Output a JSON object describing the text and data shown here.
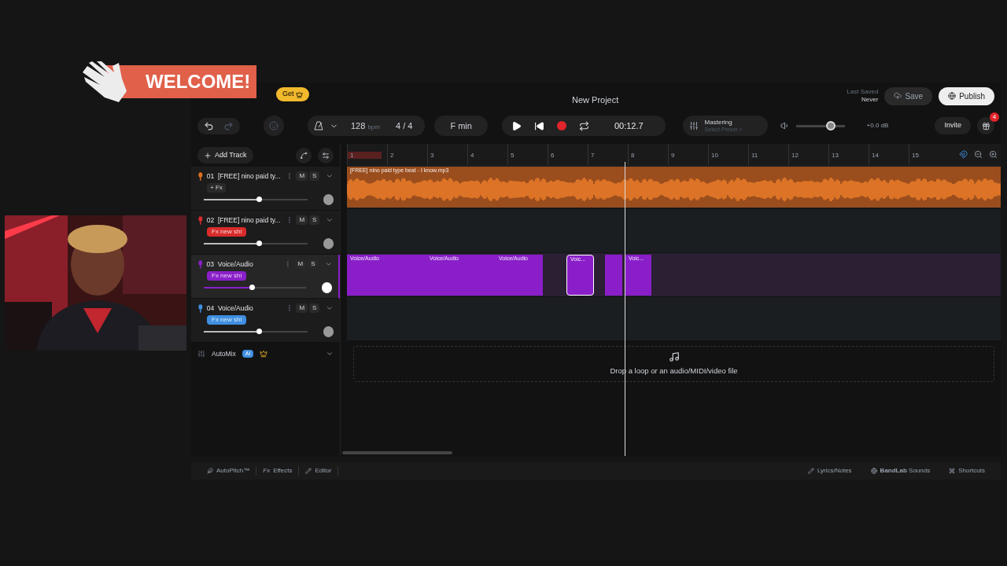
{
  "overlay": {
    "welcome": "WELCOME!"
  },
  "header": {
    "get_button": "Get",
    "title": "New Project",
    "last_saved_label": "Last Saved",
    "last_saved_value": "Never",
    "save": "Save",
    "publish": "Publish"
  },
  "toolbar": {
    "tempo": "128",
    "tempo_unit": "bpm",
    "time_signature": "4 / 4",
    "key": "F min",
    "time": "00:12.7",
    "mastering_title": "Mastering",
    "mastering_preset": "Select Preset >",
    "master_volume": {
      "level": 0.72
    },
    "master_reading": "+0.0 dB",
    "invite": "Invite",
    "notification_count": "4"
  },
  "track_panel": {
    "add_track": "Add Track"
  },
  "tracks": [
    {
      "number": "01",
      "name": "[FREE] nino paid ty...",
      "mute": "M",
      "solo": "S",
      "color": "#e0701f",
      "fx": {
        "kind": "plain",
        "label": "+ Fx"
      },
      "selected": false,
      "volume": {
        "level": 0.53
      },
      "clips": [
        {
          "label": "[FREE] nino paid type beat - I know.mp3",
          "selected": false
        }
      ]
    },
    {
      "number": "02",
      "name": "[FREE] nino paid ty...",
      "mute": "M",
      "solo": "S",
      "color": "#d92b2b",
      "fx": {
        "kind": "tag",
        "label": "Fx new shi",
        "color": "#d92b2b"
      },
      "selected": false,
      "volume": {
        "level": 0.53
      }
    },
    {
      "number": "03",
      "name": "Voice/Audio",
      "mute": "M",
      "solo": "S",
      "color": "#8a1fc9",
      "fx": {
        "kind": "tag",
        "label": "Fx new shi",
        "color": "#8a1fc9"
      },
      "selected": true,
      "volume": {
        "level": 0.47
      },
      "clips": [
        {
          "label": "Voice/Audio",
          "selected": false
        },
        {
          "label": "Voice/Audio",
          "selected": false
        },
        {
          "label": "Voice/Audio",
          "selected": false
        },
        {
          "label": "Voic...",
          "selected": true
        },
        {
          "selected": false
        },
        {
          "label": "Voic...",
          "selected": false
        }
      ]
    },
    {
      "number": "04",
      "name": "Voice/Audio",
      "mute": "M",
      "solo": "S",
      "color": "#3f8fe0",
      "fx": {
        "kind": "tag",
        "label": "Fx new shi",
        "color": "#3f8fe0"
      },
      "selected": false,
      "volume": {
        "level": 0.53
      }
    }
  ],
  "automix": {
    "label": "AutoMix",
    "badge": "AI"
  },
  "ruler": {
    "bars": [
      "1",
      "2",
      "3",
      "4",
      "5",
      "6",
      "7",
      "8",
      "9",
      "10",
      "11",
      "12",
      "13",
      "14",
      "15"
    ]
  },
  "drop_zone": {
    "text": "Drop a loop or an audio/MIDI/video file"
  },
  "bottom_bar": {
    "left": [
      {
        "kind": "autopitch",
        "label": "AutoPitch™"
      },
      {
        "kind": "fx",
        "prefix": "Fx",
        "label": "Effects"
      },
      {
        "kind": "editor",
        "label": "Editor"
      }
    ],
    "right": [
      {
        "kind": "lyrics",
        "label": "Lyrics/Notes"
      },
      {
        "kind": "sounds",
        "label": "**BandLab** Sounds"
      },
      {
        "kind": "shortcuts",
        "label": "Shortcuts"
      }
    ]
  }
}
